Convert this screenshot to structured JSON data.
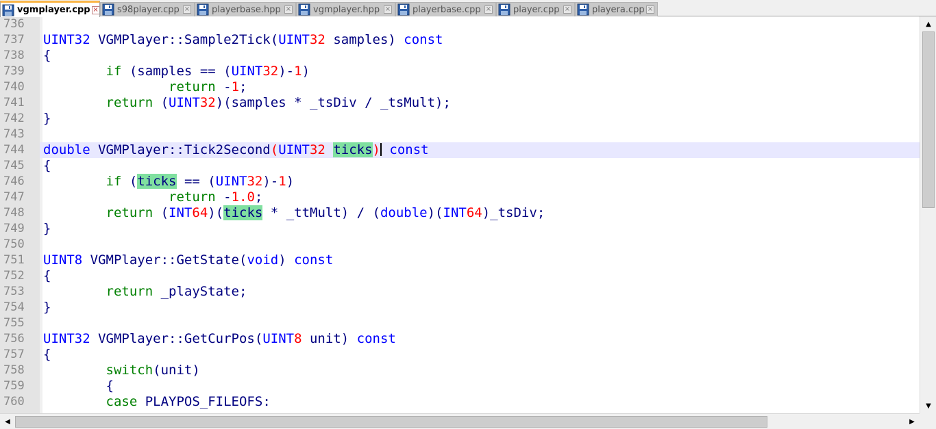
{
  "tabs": [
    {
      "label": "vgmplayer.cpp",
      "active": true
    },
    {
      "label": "s98player.cpp",
      "active": false
    },
    {
      "label": "playerbase.hpp",
      "active": false
    },
    {
      "label": "vgmplayer.hpp",
      "active": false
    },
    {
      "label": "playerbase.cpp",
      "active": false
    },
    {
      "label": "player.cpp",
      "active": false
    },
    {
      "label": "playera.cpp",
      "active": false
    }
  ],
  "icons": {
    "file": "floppy-disk-icon",
    "close": "close-icon"
  },
  "colors": {
    "keyword": "#0000ff",
    "number": "#ff0000",
    "control": "#008000",
    "highlight": "#80e0a0",
    "current_line": "#e8e8ff",
    "gutter": "#e4e4e4",
    "active_tab_accent": "#fab648"
  },
  "editor": {
    "current_line": "744",
    "lines": [
      {
        "num": "736",
        "tokens": []
      },
      {
        "num": "737",
        "tokens": [
          [
            "ty",
            "UINT32 "
          ],
          [
            "id",
            "VGMPlayer"
          ],
          [
            "op",
            "::"
          ],
          [
            "id",
            "Sample2Tick"
          ],
          [
            "op",
            "("
          ],
          [
            "ty",
            "UINT"
          ],
          [
            "nm",
            "32"
          ],
          [
            "id",
            " samples"
          ],
          [
            "op",
            ")"
          ],
          [
            "ty",
            " const"
          ]
        ]
      },
      {
        "num": "738",
        "tokens": [
          [
            "op",
            "{"
          ]
        ]
      },
      {
        "num": "739",
        "tokens": [
          [
            "sp",
            "        "
          ],
          [
            "ctl",
            "if"
          ],
          [
            "op",
            " ("
          ],
          [
            "id",
            "samples"
          ],
          [
            "op",
            " == ("
          ],
          [
            "ty",
            "UINT"
          ],
          [
            "nm",
            "32"
          ],
          [
            "op",
            ")-"
          ],
          [
            "nm",
            "1"
          ],
          [
            "op",
            ")"
          ]
        ]
      },
      {
        "num": "740",
        "tokens": [
          [
            "sp",
            "                "
          ],
          [
            "ctl",
            "return"
          ],
          [
            "op",
            " -"
          ],
          [
            "nm",
            "1"
          ],
          [
            "op",
            ";"
          ]
        ]
      },
      {
        "num": "741",
        "tokens": [
          [
            "sp",
            "        "
          ],
          [
            "ctl",
            "return"
          ],
          [
            "op",
            " ("
          ],
          [
            "ty",
            "UINT"
          ],
          [
            "nm",
            "32"
          ],
          [
            "op",
            ")("
          ],
          [
            "id",
            "samples"
          ],
          [
            "op",
            " * "
          ],
          [
            "id",
            "_tsDiv"
          ],
          [
            "op",
            " / "
          ],
          [
            "id",
            "_tsMult"
          ],
          [
            "op",
            ");"
          ]
        ]
      },
      {
        "num": "742",
        "tokens": [
          [
            "op",
            "}"
          ]
        ]
      },
      {
        "num": "743",
        "tokens": []
      },
      {
        "num": "744",
        "tokens": [
          [
            "ty",
            "double "
          ],
          [
            "id",
            "VGMPlayer"
          ],
          [
            "op",
            "::"
          ],
          [
            "id",
            "Tick2Second"
          ],
          [
            "br",
            "("
          ],
          [
            "ty",
            "UINT"
          ],
          [
            "nm",
            "32"
          ],
          [
            "sp",
            " "
          ],
          [
            "hl",
            "ticks"
          ],
          [
            "br",
            ")"
          ],
          [
            "ty",
            " const"
          ]
        ],
        "caret_after": 9
      },
      {
        "num": "745",
        "tokens": [
          [
            "op",
            "{"
          ]
        ]
      },
      {
        "num": "746",
        "tokens": [
          [
            "sp",
            "        "
          ],
          [
            "ctl",
            "if"
          ],
          [
            "op",
            " ("
          ],
          [
            "hl",
            "ticks"
          ],
          [
            "op",
            " == ("
          ],
          [
            "ty",
            "UINT"
          ],
          [
            "nm",
            "32"
          ],
          [
            "op",
            ")-"
          ],
          [
            "nm",
            "1"
          ],
          [
            "op",
            ")"
          ]
        ]
      },
      {
        "num": "747",
        "tokens": [
          [
            "sp",
            "                "
          ],
          [
            "ctl",
            "return"
          ],
          [
            "op",
            " -"
          ],
          [
            "nm",
            "1.0"
          ],
          [
            "op",
            ";"
          ]
        ]
      },
      {
        "num": "748",
        "tokens": [
          [
            "sp",
            "        "
          ],
          [
            "ctl",
            "return"
          ],
          [
            "op",
            " ("
          ],
          [
            "ty",
            "INT"
          ],
          [
            "nm",
            "64"
          ],
          [
            "op",
            ")("
          ],
          [
            "hl",
            "ticks"
          ],
          [
            "op",
            " * "
          ],
          [
            "id",
            "_ttMult"
          ],
          [
            "op",
            ") / ("
          ],
          [
            "ty",
            "double"
          ],
          [
            "op",
            ")("
          ],
          [
            "ty",
            "INT"
          ],
          [
            "nm",
            "64"
          ],
          [
            "op",
            ")"
          ],
          [
            "id",
            "_tsDiv"
          ],
          [
            "op",
            ";"
          ]
        ]
      },
      {
        "num": "749",
        "tokens": [
          [
            "op",
            "}"
          ]
        ]
      },
      {
        "num": "750",
        "tokens": []
      },
      {
        "num": "751",
        "tokens": [
          [
            "ty",
            "UINT8 "
          ],
          [
            "id",
            "VGMPlayer"
          ],
          [
            "op",
            "::"
          ],
          [
            "id",
            "GetState"
          ],
          [
            "op",
            "("
          ],
          [
            "ty",
            "void"
          ],
          [
            "op",
            ")"
          ],
          [
            "ty",
            " const"
          ]
        ]
      },
      {
        "num": "752",
        "tokens": [
          [
            "op",
            "{"
          ]
        ]
      },
      {
        "num": "753",
        "tokens": [
          [
            "sp",
            "        "
          ],
          [
            "ctl",
            "return"
          ],
          [
            "id",
            " _playState"
          ],
          [
            "op",
            ";"
          ]
        ]
      },
      {
        "num": "754",
        "tokens": [
          [
            "op",
            "}"
          ]
        ]
      },
      {
        "num": "755",
        "tokens": []
      },
      {
        "num": "756",
        "tokens": [
          [
            "ty",
            "UINT32 "
          ],
          [
            "id",
            "VGMPlayer"
          ],
          [
            "op",
            "::"
          ],
          [
            "id",
            "GetCurPos"
          ],
          [
            "op",
            "("
          ],
          [
            "ty",
            "UINT"
          ],
          [
            "nm",
            "8"
          ],
          [
            "id",
            " unit"
          ],
          [
            "op",
            ")"
          ],
          [
            "ty",
            " const"
          ]
        ]
      },
      {
        "num": "757",
        "tokens": [
          [
            "op",
            "{"
          ]
        ]
      },
      {
        "num": "758",
        "tokens": [
          [
            "sp",
            "        "
          ],
          [
            "ctl",
            "switch"
          ],
          [
            "op",
            "("
          ],
          [
            "id",
            "unit"
          ],
          [
            "op",
            ")"
          ]
        ]
      },
      {
        "num": "759",
        "tokens": [
          [
            "sp",
            "        "
          ],
          [
            "op",
            "{"
          ]
        ]
      },
      {
        "num": "760",
        "tokens": [
          [
            "sp",
            "        "
          ],
          [
            "ctl",
            "case"
          ],
          [
            "id",
            " PLAYPOS_FILEOFS"
          ],
          [
            "op",
            ":"
          ]
        ]
      }
    ]
  },
  "scrollbars": {
    "up": "▲",
    "down": "▼",
    "left": "◀",
    "right": "▶"
  }
}
